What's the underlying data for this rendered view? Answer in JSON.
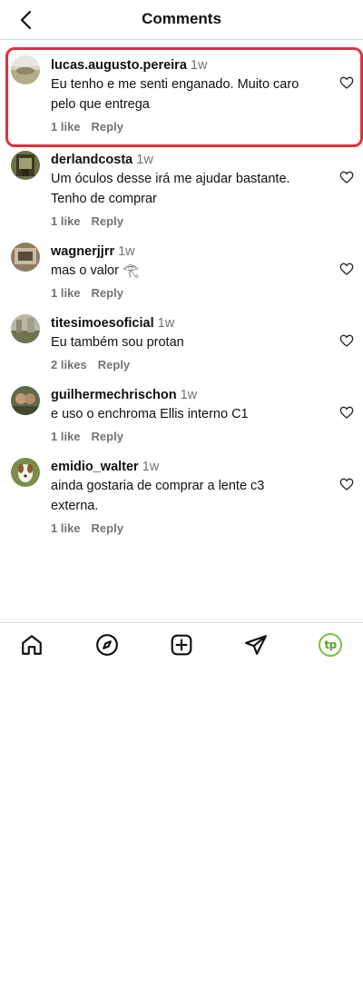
{
  "header": {
    "title": "Comments"
  },
  "comments": [
    {
      "username": "lucas.augusto.pereira",
      "time": "1w",
      "text_lines": [
        "Eu tenho e me senti enganado. Muito caro",
        "pelo que entrega"
      ],
      "likes": "1 like",
      "reply": "Reply",
      "highlighted": true
    },
    {
      "username": "derlandcosta",
      "time": "1w",
      "text_lines": [
        "Um óculos desse irá me ajudar bastante.",
        "Tenho de comprar"
      ],
      "likes": "1 like",
      "reply": "Reply"
    },
    {
      "username": "wagnerjjrr",
      "time": "1w",
      "text_lines": [
        "mas o valor 𓂀"
      ],
      "likes": "1 like",
      "reply": "Reply"
    },
    {
      "username": "titesimoesoficial",
      "time": "1w",
      "text_lines": [
        "Eu também sou protan"
      ],
      "likes": "2 likes",
      "reply": "Reply"
    },
    {
      "username": "guilhermechrischon",
      "time": "1w",
      "text_lines": [
        "e uso o enchroma Ellis interno C1"
      ],
      "likes": "1 like",
      "reply": "Reply"
    },
    {
      "username": "emidio_walter",
      "time": "1w",
      "text_lines": [
        "ainda gostaria de comprar a lente c3",
        "externa."
      ],
      "likes": "1 like",
      "reply": "Reply"
    }
  ],
  "tabbar": {
    "profile_initials": "tp",
    "icons": [
      "home-icon",
      "explore-icon",
      "new-post-icon",
      "direct-icon",
      "profile-icon"
    ]
  },
  "colors": {
    "highlight": "#e0313f",
    "muted": "#737373",
    "profile_ring": "#7ac142"
  }
}
